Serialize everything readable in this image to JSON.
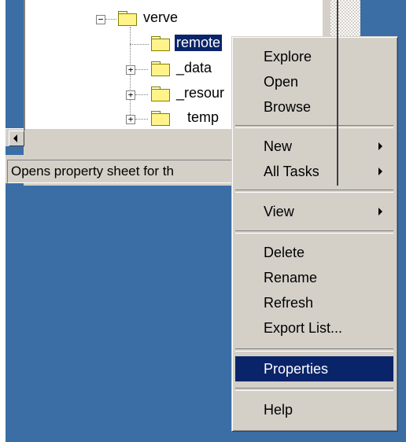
{
  "tree": {
    "items": [
      {
        "label": "verve",
        "expander": "−"
      },
      {
        "label": "remote",
        "selected": true
      },
      {
        "label": "_data",
        "expander": "+"
      },
      {
        "label": "_resour",
        "expander": "+"
      },
      {
        "label": "temp",
        "expander": "+"
      }
    ]
  },
  "status_bar": {
    "text": "Opens property sheet for th"
  },
  "context_menu": {
    "items": [
      {
        "label": "Explore"
      },
      {
        "label": "Open"
      },
      {
        "label": "Browse"
      },
      {
        "label": "New",
        "submenu": true
      },
      {
        "label": "All Tasks",
        "submenu": true
      },
      {
        "label": "View",
        "submenu": true
      },
      {
        "label": "Delete"
      },
      {
        "label": "Rename"
      },
      {
        "label": "Refresh"
      },
      {
        "label": "Export List..."
      },
      {
        "label": "Properties",
        "highlighted": true
      },
      {
        "label": "Help"
      }
    ]
  },
  "colors": {
    "desktop": "#3a6ea5",
    "highlight": "#0a246a",
    "face": "#d4d0c8"
  }
}
